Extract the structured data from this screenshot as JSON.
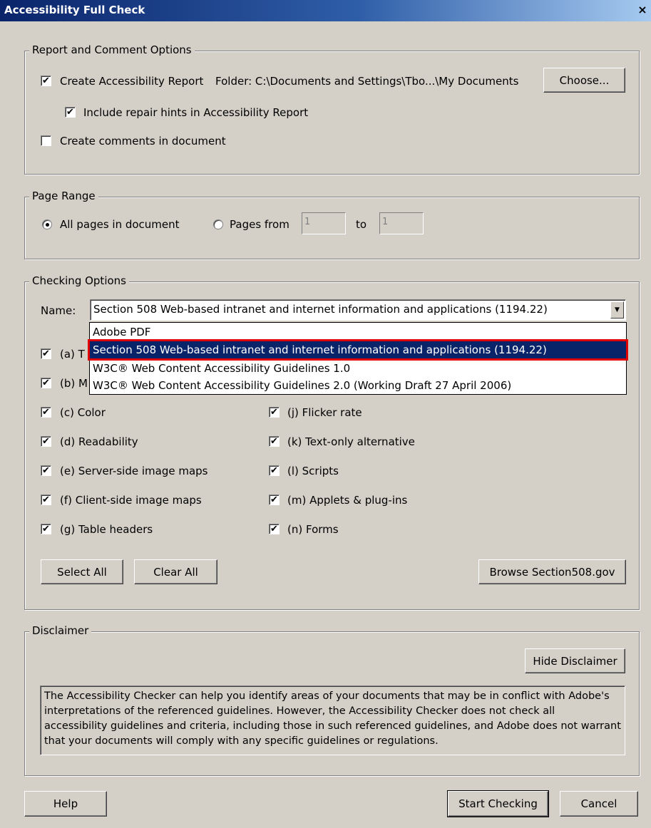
{
  "window": {
    "title": "Accessibility Full Check",
    "close_glyph": "×"
  },
  "report": {
    "group_title": "Report and Comment Options",
    "create_report": {
      "label": "Create Accessibility Report",
      "checked": true
    },
    "folder": "Folder: C:\\Documents and Settings\\Tbo...\\My Documents",
    "choose_button": "Choose...",
    "include_hints": {
      "label": "Include repair hints in Accessibility Report",
      "checked": true
    },
    "create_comments": {
      "label": "Create comments in document",
      "checked": false
    }
  },
  "page_range": {
    "group_title": "Page Range",
    "all_pages": {
      "label": "All pages in document",
      "selected": true
    },
    "pages_from": {
      "label": "Pages from",
      "selected": false
    },
    "from_value": "1",
    "to_label": "to",
    "to_value": "1"
  },
  "checking": {
    "group_title": "Checking Options",
    "name_label": "Name:",
    "selected_name": "Section 508 Web-based intranet and internet information and applications (1194.22)",
    "dropdown_options": [
      "Adobe PDF",
      "Section 508 Web-based intranet and internet information and applications (1194.22)",
      "W3C® Web Content Accessibility Guidelines 1.0",
      "W3C® Web Content Accessibility Guidelines 2.0 (Working Draft 27 April 2006)"
    ],
    "left_items": [
      {
        "label": "(a) T",
        "checked": true
      },
      {
        "label": "(b) M",
        "checked": true
      },
      {
        "label": "(c) Color",
        "checked": true
      },
      {
        "label": "(d) Readability",
        "checked": true
      },
      {
        "label": "(e) Server-side image maps",
        "checked": true
      },
      {
        "label": "(f) Client-side image maps",
        "checked": true
      },
      {
        "label": "(g) Table headers",
        "checked": true
      }
    ],
    "right_items": [
      {
        "label": "(j) Flicker rate",
        "checked": true
      },
      {
        "label": "(k) Text-only alternative",
        "checked": true
      },
      {
        "label": "(l) Scripts",
        "checked": true
      },
      {
        "label": "(m) Applets & plug-ins",
        "checked": true
      },
      {
        "label": "(n) Forms",
        "checked": true
      }
    ],
    "select_all": "Select All",
    "clear_all": "Clear All",
    "browse": "Browse Section508.gov"
  },
  "disclaimer": {
    "group_title": "Disclaimer",
    "hide_button": "Hide Disclaimer",
    "text": "The Accessibility Checker can help you identify areas of your documents that may be in conflict with Adobe's interpretations of the referenced guidelines. However, the Accessibility Checker does not check all accessibility guidelines and criteria, including those in such referenced guidelines, and Adobe does not warrant that your documents will comply with any specific guidelines or regulations."
  },
  "footer": {
    "help": "Help",
    "start": "Start Checking",
    "cancel": "Cancel"
  },
  "icons": {
    "check": "✔",
    "combo_arrow": "▼"
  }
}
